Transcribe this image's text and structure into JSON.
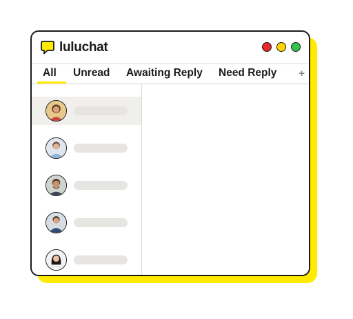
{
  "app": {
    "brand": "luluchat"
  },
  "window_controls": {
    "close_color": "#E8282B",
    "minimize_color": "#FFD400",
    "maximize_color": "#33C24D"
  },
  "tabs": [
    {
      "label": "All",
      "active": true
    },
    {
      "label": "Unread",
      "active": false
    },
    {
      "label": "Awaiting Reply",
      "active": false
    },
    {
      "label": "Need Reply",
      "active": false
    }
  ],
  "add_tab_label": "+",
  "colors": {
    "accent": "#FFEB00",
    "selected_row": "#f0efeb",
    "placeholder": "#e6e5e2"
  },
  "contacts": [
    {
      "avatar": "avatar-woman-1",
      "selected": true
    },
    {
      "avatar": "avatar-man-1",
      "selected": false
    },
    {
      "avatar": "avatar-man-2",
      "selected": false
    },
    {
      "avatar": "avatar-man-3",
      "selected": false
    },
    {
      "avatar": "avatar-woman-2",
      "selected": false
    }
  ]
}
